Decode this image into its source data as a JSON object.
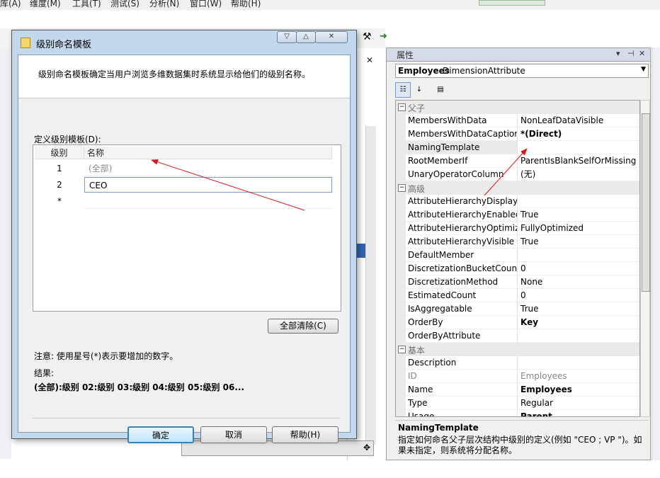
{
  "menu": [
    "库(A)",
    "维度(M)",
    "工具(T)",
    "测试(S)",
    "分析(N)",
    "窗口(W)",
    "帮助(H)"
  ],
  "dialog": {
    "title": "级别命名模板",
    "description": "级别命名模板确定当用户浏览多维数据集时系统显示给他们的级别名称。",
    "define_label": "定义级别模板(D):",
    "col_level": "级别",
    "col_name": "名称",
    "rows": [
      {
        "level": "1",
        "name": "(全部)"
      },
      {
        "level": "2",
        "name": "CEO"
      },
      {
        "level": "*",
        "name": ""
      }
    ],
    "clear_label": "全部清除(C)",
    "note": "注意: 使用星号(*)表示要增加的数字。",
    "result_label": "结果:",
    "result_value": "(全部):级别 02:级别 03:级别 04:级别 05:级别 06...",
    "ok_label": "确定",
    "cancel_label": "取消",
    "help_label": "帮助(H)"
  },
  "properties": {
    "title": "属性",
    "object_name": "Employees",
    "object_type": "DimensionAttribute",
    "categories": [
      {
        "name": "父子",
        "props": [
          {
            "name": "MembersWithData",
            "value": "NonLeafDataVisible",
            "bold": false
          },
          {
            "name": "MembersWithDataCaption",
            "value": "*(Direct)",
            "bold": true
          },
          {
            "name": "NamingTemplate",
            "value": "",
            "bold": false,
            "selected": true
          },
          {
            "name": "RootMemberIf",
            "value": "ParentIsBlankSelfOrMissing",
            "bold": false
          },
          {
            "name": "UnaryOperatorColumn",
            "value": "(无)",
            "bold": false
          }
        ]
      },
      {
        "name": "高级",
        "props": [
          {
            "name": "AttributeHierarchyDisplayFol",
            "value": "",
            "bold": false
          },
          {
            "name": "AttributeHierarchyEnabled",
            "value": "True",
            "bold": false
          },
          {
            "name": "AttributeHierarchyOptimized",
            "value": "FullyOptimized",
            "bold": false
          },
          {
            "name": "AttributeHierarchyVisible",
            "value": "True",
            "bold": false
          },
          {
            "name": "DefaultMember",
            "value": "",
            "bold": false
          },
          {
            "name": "DiscretizationBucketCount",
            "value": "0",
            "bold": false
          },
          {
            "name": "DiscretizationMethod",
            "value": "None",
            "bold": false
          },
          {
            "name": "EstimatedCount",
            "value": "0",
            "bold": false
          },
          {
            "name": "IsAggregatable",
            "value": "True",
            "bold": false
          },
          {
            "name": "OrderBy",
            "value": "Key",
            "bold": true
          },
          {
            "name": "OrderByAttribute",
            "value": "",
            "bold": false
          }
        ]
      },
      {
        "name": "基本",
        "props": [
          {
            "name": "Description",
            "value": "",
            "bold": false
          },
          {
            "name": "ID",
            "value": "Employees",
            "bold": false,
            "gray": true
          },
          {
            "name": "Name",
            "value": "Employees",
            "bold": true
          },
          {
            "name": "Type",
            "value": "Regular",
            "bold": false
          },
          {
            "name": "Usage",
            "value": "Parent",
            "bold": true
          }
        ]
      }
    ],
    "desc_title": "NamingTemplate",
    "desc_text": "指定如何命名父子层次结构中级别的定义(例如 \"CEO ; VP \")。如果未指定，则系统将分配名称。"
  },
  "colors": {
    "arrow": "#d9161b",
    "dialog_frame": "#c3d7ed",
    "prop_category": "#eaeaea"
  }
}
